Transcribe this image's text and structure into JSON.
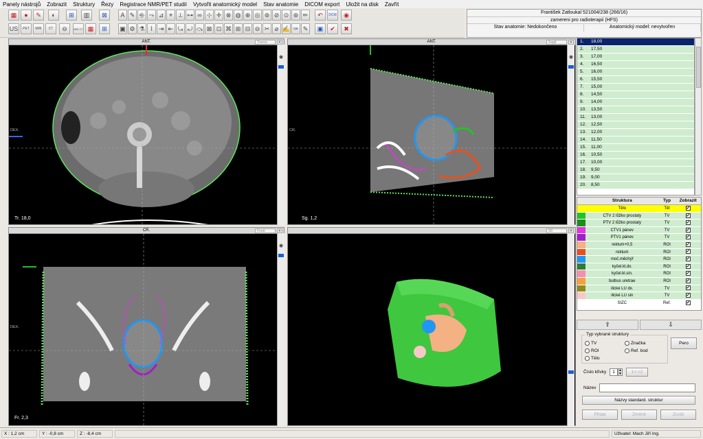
{
  "menu": [
    "Panely nástrojů",
    "Zobrazit",
    "Struktury",
    "Řezy",
    "Registrace NMR/PET studií",
    "Vytvořit anatomický model",
    "Stav anatomie",
    "DICOM export",
    "Uložit na disk",
    "Zavřít"
  ],
  "toolbar_labels": {
    "us": "US",
    "pet": "PET",
    "mri": "MRI",
    "ct": "CT",
    "mri_ct": "MRI CT",
    "dcm": "DCM"
  },
  "patient": {
    "name": "František Zatloukal 521004/238 (266/16)",
    "plan": "zamereni pro radioterapii   (HFS)",
    "anatomy_state": "Stav anatomie: Nedokončeno",
    "anatomy_model": "Anatomický model: nevytvořen"
  },
  "views": {
    "axial": {
      "top": "ANT.",
      "side": "DEX.",
      "label": "Tr. 18,0",
      "mode": "Transv"
    },
    "sagittal": {
      "top": "ANT.",
      "side": "CR.",
      "label": "Sg. 1,2",
      "mode": "Sagit"
    },
    "coronal": {
      "top": "CR.",
      "side": "DEX.",
      "label": "Fr. 2,3",
      "mode": "Front"
    },
    "three_d": {
      "mode": "3D"
    }
  },
  "slices": [
    "18,00",
    "17,50",
    "17,00",
    "16,50",
    "16,00",
    "15,50",
    "15,00",
    "14,50",
    "14,00",
    "13,50",
    "13,00",
    "12,50",
    "12,00",
    "11,50",
    "11,00",
    "10,50",
    "10,00",
    "9,50",
    "9,00",
    "8,50"
  ],
  "slice_selected": 0,
  "structures_header": {
    "name": "Struktura",
    "type": "Typ",
    "show": "Zobrazit"
  },
  "structures": [
    {
      "name": "Tělo",
      "type": "Těl",
      "color": "#ffff00",
      "bg": "#ffff00",
      "checked": "✔"
    },
    {
      "name": "CTV 2 lůžko prostaty",
      "type": "TV",
      "color": "#22c322",
      "bg": "#cfeccf",
      "checked": "✔"
    },
    {
      "name": "PTV 2 lůžko prostaty",
      "type": "TV",
      "color": "#1a8f1a",
      "bg": "#cfeccf",
      "checked": "✔"
    },
    {
      "name": "CTV1 pánev",
      "type": "TV",
      "color": "#e432e4",
      "bg": "#cfeccf",
      "checked": "✔"
    },
    {
      "name": "PTV1 pánev",
      "type": "TV",
      "color": "#a020c8",
      "bg": "#cfeccf",
      "checked": "✔"
    },
    {
      "name": "rektum+0,5",
      "type": "ROI",
      "color": "#f4b183",
      "bg": "#cfeccf",
      "checked": "✔"
    },
    {
      "name": "rektum",
      "type": "ROI",
      "color": "#e8501e",
      "bg": "#cfeccf",
      "checked": "✔"
    },
    {
      "name": "moč.měchýř",
      "type": "ROI",
      "color": "#2196f3",
      "bg": "#cfeccf",
      "checked": "✔"
    },
    {
      "name": "kyčel.kl.dx.",
      "type": "ROI",
      "color": "#2e7d32",
      "bg": "#cfeccf",
      "checked": "✔"
    },
    {
      "name": "kyčel.kl.sin.",
      "type": "ROI",
      "color": "#f48fb1",
      "bg": "#cfeccf",
      "checked": "✔"
    },
    {
      "name": "bulbus uretrae",
      "type": "ROI",
      "color": "#f4a040",
      "bg": "#cfeccf",
      "checked": "✔"
    },
    {
      "name": "ilické LU dx.",
      "type": "TV",
      "color": "#8d8d1a",
      "bg": "#cfeccf",
      "checked": "✔"
    },
    {
      "name": "ilické LU sin",
      "type": "TV",
      "color": "#f8c8c8",
      "bg": "#cfeccf",
      "checked": "✔"
    },
    {
      "name": "SIZC",
      "type": "Ref.",
      "color": "#ffffff",
      "bg": "#ffffff",
      "checked": "✔"
    }
  ],
  "arrows": {
    "up": "⇧",
    "down": "⇩"
  },
  "struct_panel": {
    "legend": "Typ vybrané struktury",
    "tv": "TV",
    "roi": "ROI",
    "telo": "Tělo",
    "znacka": "Značka",
    "ref_bod": "Ref. bod",
    "pero": "Pero",
    "curve_label": "Číslo křivky",
    "curve_value": "1",
    "curve_btn": "1<->2",
    "name_label": "Název",
    "name_value": "",
    "std_names": "Názvy standard. struktur",
    "add": "Přidat",
    "change": "Změnit",
    "cancel": "Zrušit"
  },
  "status": {
    "x": "X : 1,2 cm",
    "y": "Y : -0,8 cm",
    "z": "Z : -8,4 cm",
    "user": "Uživatel: Mach Jiří Ing."
  }
}
